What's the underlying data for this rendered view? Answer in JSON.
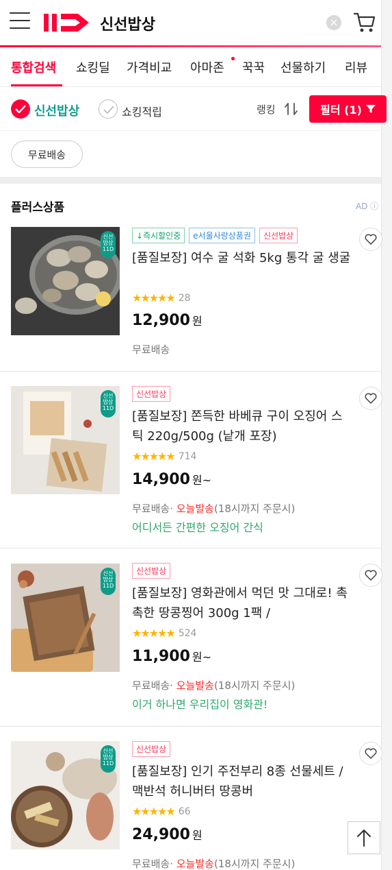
{
  "header": {
    "search_query": "신선밥상",
    "clear_label": "×"
  },
  "tabs": [
    {
      "label": "통합검색",
      "active": true
    },
    {
      "label": "쇼킹딜",
      "active": false
    },
    {
      "label": "가격비교",
      "active": false
    },
    {
      "label": "아마존",
      "active": false,
      "dot": true
    },
    {
      "label": "꾹꾹",
      "active": false
    },
    {
      "label": "선물하기",
      "active": false
    },
    {
      "label": "리뷰",
      "active": false
    }
  ],
  "filters": {
    "check1": {
      "label": "신선밥상",
      "checked": true
    },
    "check2": {
      "label": "쇼킹적립",
      "checked": false
    },
    "sort_label": "랭킹",
    "filter_button": "필터 (1)",
    "chip": "무료배송"
  },
  "section": {
    "title": "플러스상품",
    "ad": "AD"
  },
  "products": [
    {
      "tags": [
        {
          "text": "↓즉시할인중",
          "color": "green"
        },
        {
          "text": "e서울사랑상품권",
          "color": "blue"
        },
        {
          "text": "신선밥상",
          "color": "red"
        }
      ],
      "name": "[품질보장] 여수 굴 석화 5kg 통각 굴 생굴",
      "rating": 4.5,
      "review_count": "28",
      "price": "12,900",
      "price_unit": "원",
      "shipping": "무료배송",
      "today": "",
      "today_note": "",
      "promo": ""
    },
    {
      "tags": [
        {
          "text": "신선밥상",
          "color": "red"
        }
      ],
      "name": "[품질보장] 쫀득한 바베큐 구이 오징어 스틱 220g/500g (낱개 포장)",
      "rating": 4.5,
      "review_count": "714",
      "price": "14,900",
      "price_unit": "원~",
      "shipping": "무료배송·",
      "today": "오늘발송",
      "today_note": "(18시까지 주문시)",
      "promo": "어디서든 간편한 오징어 간식"
    },
    {
      "tags": [
        {
          "text": "신선밥상",
          "color": "red"
        }
      ],
      "name": "[품질보장] 영화관에서 먹던 맛 그대로! 촉촉한 땅콩찡어 300g 1팩 /",
      "rating": 4.5,
      "review_count": "524",
      "price": "11,900",
      "price_unit": "원~",
      "shipping": "무료배송·",
      "today": "오늘발송",
      "today_note": "(18시까지 주문시)",
      "promo": "이거 하나면 우리집이 영화관!"
    },
    {
      "tags": [
        {
          "text": "신선밥상",
          "color": "red"
        }
      ],
      "name": "[품질보장] 인기 주전부리 8종 선물세트 / 맥반석 허니버터 땅콩버",
      "rating": 4.5,
      "review_count": "66",
      "price": "24,900",
      "price_unit": "원",
      "shipping": "무료배송·",
      "today": "오늘발송",
      "today_note": "(18시까지 주문시)",
      "promo": ""
    }
  ],
  "seal_text": "신선\n밥상\n11D",
  "colors": {
    "brand": "#ff0038",
    "fresh_green": "#0f9d8f",
    "star": "#ffb400"
  }
}
